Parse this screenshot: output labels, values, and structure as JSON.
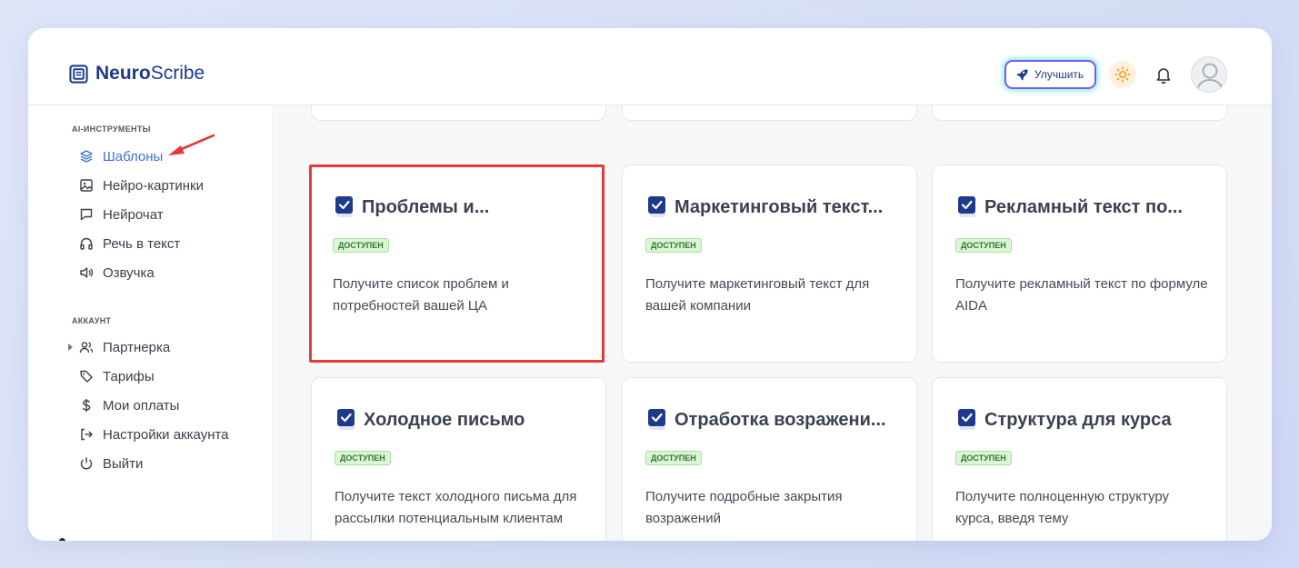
{
  "header": {
    "logo_bold": "Neuro",
    "logo_light": "Scribe",
    "upgrade_label": "Улучшить",
    "upgrade_icon": "rocket-icon",
    "theme_icon": "sun-icon",
    "notification_icon": "bell-icon",
    "avatar_icon": "user-avatar-icon"
  },
  "sidebar": {
    "tools_section": "AI-ИНСТРУМЕНТЫ",
    "tools": [
      {
        "label": "Шаблоны",
        "icon": "layers-icon",
        "active": true
      },
      {
        "label": "Нейро-картинки",
        "icon": "image-icon"
      },
      {
        "label": "Нейрочат",
        "icon": "chat-icon"
      },
      {
        "label": "Речь в текст",
        "icon": "headphones-icon"
      },
      {
        "label": "Озвучка",
        "icon": "speaker-icon"
      }
    ],
    "account_section": "АККАУНТ",
    "account": [
      {
        "label": "Партнерка",
        "icon": "users-icon",
        "expandable": true
      },
      {
        "label": "Тарифы",
        "icon": "tag-icon"
      },
      {
        "label": "Мои оплаты",
        "icon": "dollar-icon"
      },
      {
        "label": "Настройки аккаунта",
        "icon": "settings-exit-icon"
      },
      {
        "label": "Выйти",
        "icon": "power-icon"
      }
    ]
  },
  "templates": [
    {
      "title": "Проблемы и...",
      "badge": "доступен",
      "description": "Получите список проблем и потребностей вашей ЦА",
      "highlighted": true
    },
    {
      "title": "Маркетинговый текст...",
      "badge": "доступен",
      "description": "Получите маркетинговый текст для вашей компании"
    },
    {
      "title": "Рекламный текст по...",
      "badge": "доступен",
      "description": "Получите рекламный текст по формуле AIDA"
    },
    {
      "title": "Холодное письмо",
      "badge": "доступен",
      "description": "Получите текст холодного письма для рассылки потенциальным клиентам"
    },
    {
      "title": "Отработка возражени...",
      "badge": "доступен",
      "description": "Получите подробные закрытия возражений"
    },
    {
      "title": "Структура для курса",
      "badge": "доступен",
      "description": "Получите полноценную структуру курса, введя тему"
    }
  ],
  "colors": {
    "brand": "#1e3a8a",
    "active_nav": "#3f6fd6",
    "highlight": "#e5393b",
    "badge_bg": "#dcf5d6",
    "badge_text": "#2d7a2d"
  }
}
